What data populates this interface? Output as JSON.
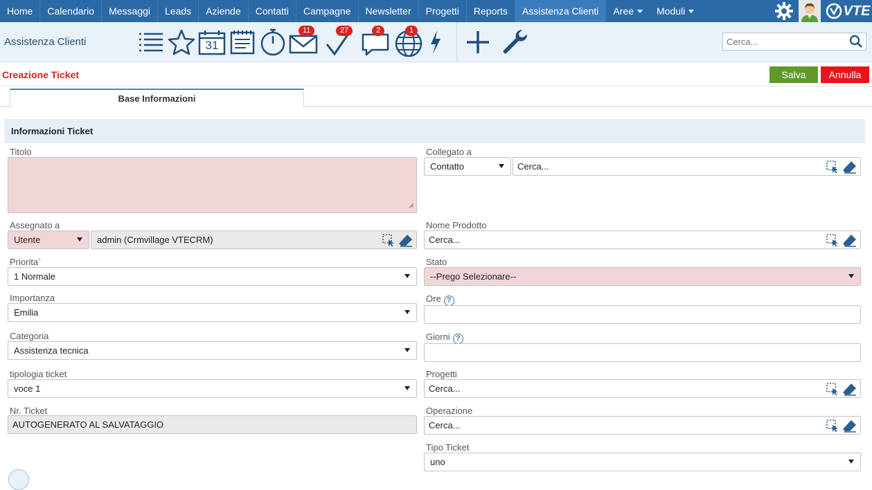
{
  "nav": {
    "items": [
      {
        "label": "Home",
        "active": false
      },
      {
        "label": "Calendario",
        "active": false
      },
      {
        "label": "Messaggi",
        "active": false
      },
      {
        "label": "Leads",
        "active": false
      },
      {
        "label": "Aziende",
        "active": false
      },
      {
        "label": "Contatti",
        "active": false
      },
      {
        "label": "Campagne",
        "active": false
      },
      {
        "label": "Newsletter",
        "active": false
      },
      {
        "label": "Progetti",
        "active": false
      },
      {
        "label": "Reports",
        "active": false
      },
      {
        "label": "Assistenza Clienti",
        "active": true
      },
      {
        "label": "Aree",
        "active": false,
        "dropdown": true
      },
      {
        "label": "Moduli",
        "active": false,
        "dropdown": true
      }
    ],
    "logo_text": "VTE",
    "icons": [
      "gear-icon",
      "user-avatar-icon",
      "vte-logo-icon"
    ]
  },
  "toolbar": {
    "module_title": "Assistenza Clienti",
    "icons": [
      {
        "name": "list-icon"
      },
      {
        "name": "star-icon"
      },
      {
        "name": "calendar-icon",
        "text": "31"
      },
      {
        "name": "notes-icon"
      },
      {
        "name": "timer-icon"
      },
      {
        "name": "mail-icon",
        "badge": "11"
      },
      {
        "name": "check-icon",
        "badge": "27"
      },
      {
        "name": "chat-icon",
        "badge": "2"
      },
      {
        "name": "globe-icon",
        "badge": "1"
      },
      {
        "name": "lightning-icon"
      },
      {
        "name": "plus-icon"
      },
      {
        "name": "wrench-icon"
      }
    ],
    "search_placeholder": "Cerca..."
  },
  "header": {
    "title": "Creazione Ticket",
    "save_label": "Salva",
    "cancel_label": "Annulla"
  },
  "tabs": [
    {
      "label": "Base Informazioni",
      "active": true
    }
  ],
  "section": {
    "title": "Informazioni Ticket"
  },
  "form": {
    "titolo": {
      "label": "Titolo",
      "value": ""
    },
    "collegato_a": {
      "label": "Collegato a",
      "type_value": "Contatto",
      "search_value": "Cerca..."
    },
    "assegnato_a": {
      "label": "Assegnato a",
      "type_value": "Utente",
      "value": "admin (Crmvillage VTECRM)"
    },
    "nome_prodotto": {
      "label": "Nome Prodotto",
      "value": "Cerca..."
    },
    "priorita": {
      "label": "Priorita`",
      "value": "1 Normale"
    },
    "stato": {
      "label": "Stato",
      "value": "--Prego Selezionare--"
    },
    "importanza": {
      "label": "Importanza",
      "value": "Emilia"
    },
    "ore": {
      "label": "Ore",
      "value": ""
    },
    "categoria": {
      "label": "Categoria",
      "value": "Assistenza tecnica"
    },
    "giorni": {
      "label": "Giorni",
      "value": ""
    },
    "tipologia_ticket": {
      "label": "tipologia ticket",
      "value": "voce 1"
    },
    "progetti": {
      "label": "Progetti",
      "value": "Cerca..."
    },
    "nr_ticket": {
      "label": "Nr. Ticket",
      "value": "AUTOGENERATO AL SALVATAGGIO"
    },
    "operazione": {
      "label": "Operazione",
      "value": "Cerca..."
    },
    "tipo_ticket": {
      "label": "Tipo Ticket",
      "value": "uno"
    }
  },
  "colors": {
    "nav_bg": "#2c6aa7",
    "toolbar_bg": "#e9f1f9",
    "title_red": "#e02020",
    "save_green": "#5f9a2b",
    "cancel_red": "#e8141a",
    "required_bg": "#f1d6d7",
    "readonly_bg": "#e9e9e9",
    "section_bg": "#e6eef7"
  }
}
